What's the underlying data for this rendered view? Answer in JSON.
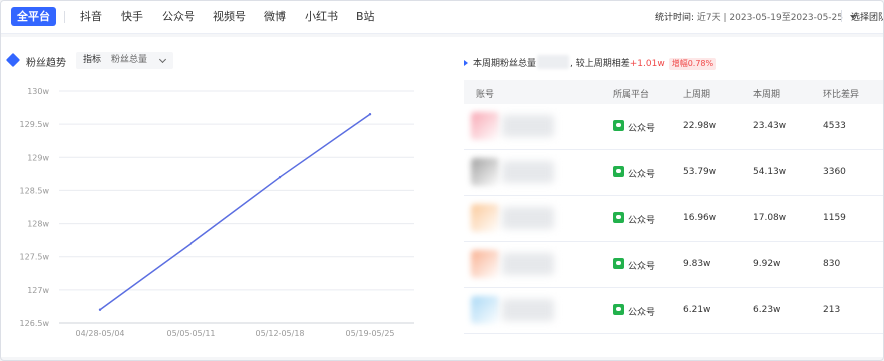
{
  "platform_tabs": [
    {
      "label": "全平台",
      "active": true
    },
    {
      "label": "抖音",
      "active": false
    },
    {
      "label": "快手",
      "active": false
    },
    {
      "label": "公众号",
      "active": false
    },
    {
      "label": "视频号",
      "active": false
    },
    {
      "label": "微博",
      "active": false
    },
    {
      "label": "小红书",
      "active": false
    },
    {
      "label": "B站",
      "active": false
    }
  ],
  "time_filter": {
    "label": "统计时间:",
    "value": "近7天 | 2023-05-19至2023-05-25"
  },
  "team_select": {
    "label": "选择团队"
  },
  "trend": {
    "title": "粉丝趋势",
    "metric_label": "指标",
    "metric_value": "粉丝总量"
  },
  "chart_data": {
    "type": "line",
    "title": "",
    "xlabel": "",
    "ylabel": "",
    "x": [
      "04/28-05/04",
      "05/05-05/11",
      "05/12-05/18",
      "05/19-05/25"
    ],
    "y_ticks": [
      "126.5w",
      "127w",
      "127.5w",
      "128w",
      "128.5w",
      "129w",
      "129.5w",
      "130w"
    ],
    "ylim": [
      126.5,
      130
    ],
    "series": [
      {
        "values": [
          126.7,
          127.7,
          128.7,
          129.65
        ]
      }
    ],
    "grid": true,
    "colors": {
      "line": "#5b6ee1",
      "grid": "#e9ebf0"
    }
  },
  "summary": {
    "prefix": "本周期粉丝总量",
    "middle": ", 较上周期相差",
    "delta": "+1.01w",
    "badge": "增幅0.78%"
  },
  "table": {
    "headers": [
      "账号",
      "所属平台",
      "上周期",
      "本周期",
      "环比差异"
    ],
    "rows": [
      {
        "avatar_color": "#f8a8b4",
        "platform": "公众号",
        "prev": "22.98w",
        "curr": "23.43w",
        "diff": "4533"
      },
      {
        "avatar_color": "#a0a0a0",
        "platform": "公众号",
        "prev": "53.79w",
        "curr": "54.13w",
        "diff": "3360"
      },
      {
        "avatar_color": "#fbc99a",
        "platform": "公众号",
        "prev": "16.96w",
        "curr": "17.08w",
        "diff": "1159"
      },
      {
        "avatar_color": "#f9b090",
        "platform": "公众号",
        "prev": "9.83w",
        "curr": "9.92w",
        "diff": "830"
      },
      {
        "avatar_color": "#a9d8f5",
        "platform": "公众号",
        "prev": "6.21w",
        "curr": "6.23w",
        "diff": "213"
      }
    ]
  },
  "colors": {
    "accent": "#3366ff",
    "up": "#f04848",
    "wechat": "#22b14c"
  }
}
